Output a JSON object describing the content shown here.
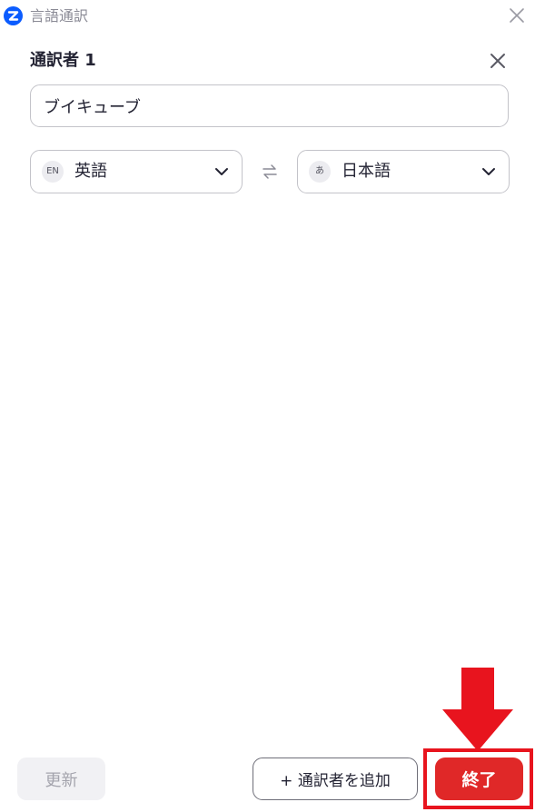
{
  "window": {
    "title": "言語通訳",
    "app_icon": "zoom-logo-icon",
    "close_icon": "close-icon"
  },
  "interpreter": {
    "title": "通訳者 1",
    "remove_icon": "close-icon",
    "name_value": "ブイキューブ",
    "source_language": {
      "badge": "EN",
      "label": "英語"
    },
    "swap_icon": "swap-arrows-icon",
    "target_language": {
      "badge": "あ",
      "label": "日本語"
    }
  },
  "footer": {
    "update_label": "更新",
    "add_interpreter_label": "+ 通訳者を追加",
    "end_label": "終了"
  },
  "colors": {
    "accent_blue": "#0b5cff",
    "end_button_red": "#e02828",
    "annotation_red": "#e8141e",
    "border_gray": "#c3c3c9",
    "text_dark": "#232333"
  }
}
